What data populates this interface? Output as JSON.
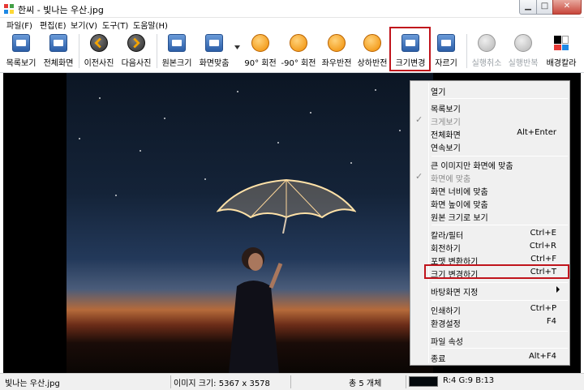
{
  "window": {
    "title": "한씨 - 빛나는 우산.jpg"
  },
  "menubar": [
    "파일(F)",
    "편집(E)",
    "보기(V)",
    "도구(T)",
    "도움말(H)"
  ],
  "toolbar": {
    "list_view": "목록보기",
    "fullscreen": "전체화면",
    "prev_photo": "이전사진",
    "next_photo": "다음사진",
    "original_size": "원본크기",
    "fit_screen": "화면맞춤",
    "rotate_90": "90° 회전",
    "rotate_minus_90": "-90° 회전",
    "flip_horizontal": "좌우반전",
    "flip_vertical": "상하반전",
    "resize": "크기변경",
    "crop": "자르기",
    "undo": "실행취소",
    "redo": "실행반복",
    "bg_color": "배경칼라"
  },
  "context_menu": {
    "items": [
      {
        "label": "열기",
        "shortcut": ""
      },
      {
        "label": "목록보기",
        "shortcut": ""
      },
      {
        "label": "크게보기",
        "shortcut": ""
      },
      {
        "label": "전체화면",
        "shortcut": "Alt+Enter"
      },
      {
        "label": "연속보기",
        "shortcut": ""
      },
      {
        "label": "큰 이미지만 화면에 맞춤",
        "shortcut": ""
      },
      {
        "label": "화면에 맞춤",
        "shortcut": ""
      },
      {
        "label": "화면 너비에 맞춤",
        "shortcut": ""
      },
      {
        "label": "화면 높이에 맞춤",
        "shortcut": ""
      },
      {
        "label": "원본 크기로 보기",
        "shortcut": ""
      },
      {
        "label": "칼라/필터",
        "shortcut": "Ctrl+E"
      },
      {
        "label": "회전하기",
        "shortcut": "Ctrl+R"
      },
      {
        "label": "포맷 변환하기",
        "shortcut": "Ctrl+F"
      },
      {
        "label": "크기 변경하기",
        "shortcut": "Ctrl+T"
      },
      {
        "label": "바탕화면 지정",
        "shortcut": ""
      },
      {
        "label": "인쇄하기",
        "shortcut": "Ctrl+P"
      },
      {
        "label": "환경설정",
        "shortcut": "F4"
      },
      {
        "label": "파일 속성",
        "shortcut": ""
      },
      {
        "label": "종료",
        "shortcut": "Alt+F4"
      }
    ]
  },
  "statusbar": {
    "filename": "빛나는 우산.jpg",
    "image_size": "이미지 크기: 5367 x 3578",
    "count": "총 5 개체",
    "swatch_color": "#04090d",
    "rgb": "R:4 G:9 B:13"
  },
  "colors": {
    "highlight": "#c0141c",
    "menu_bg": "#f0f0f0"
  }
}
